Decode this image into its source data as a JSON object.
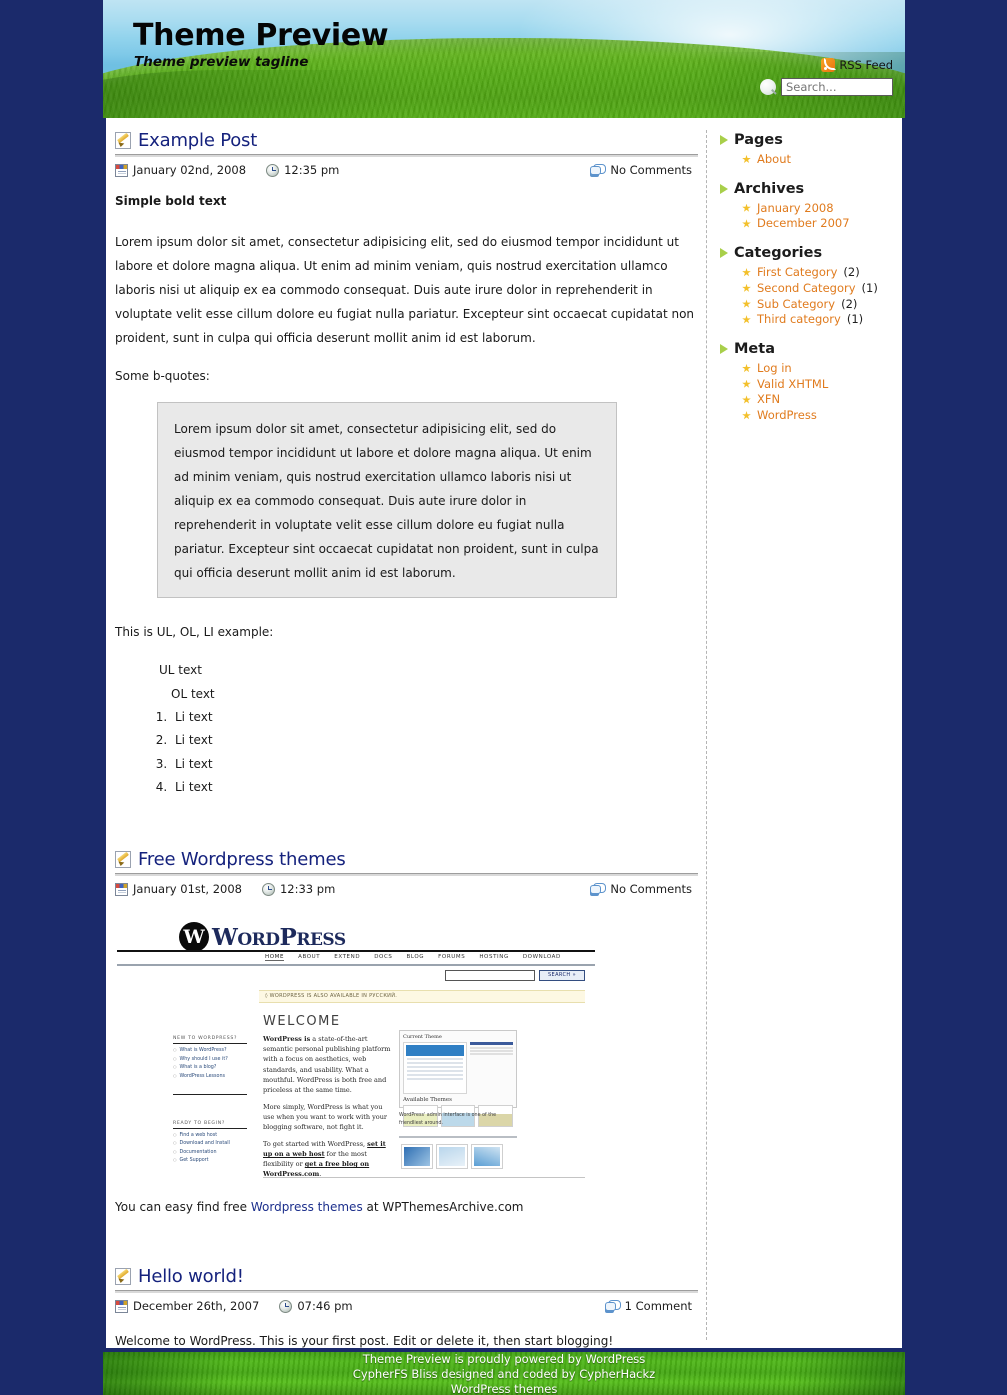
{
  "header": {
    "title": "Theme Preview",
    "tagline": "Theme preview tagline",
    "rss_label": "RSS Feed",
    "search_placeholder": "Search..."
  },
  "posts": [
    {
      "title": "Example Post",
      "date": "January 02nd, 2008",
      "time": "12:35 pm",
      "comments": "No Comments",
      "bold_lead": "Simple bold text",
      "paragraph": "Lorem ipsum dolor sit amet, consectetur adipisicing elit, sed do eiusmod tempor incididunt ut labore et dolore magna aliqua. Ut enim ad minim veniam, quis nostrud exercitation ullamco laboris nisi ut aliquip ex ea commodo consequat. Duis aute irure dolor in reprehenderit in voluptate velit esse cillum dolore eu fugiat nulla pariatur. Excepteur sint occaecat cupidatat non proident, sunt in culpa qui officia deserunt mollit anim id est laborum.",
      "bquote_intro": "Some b-quotes:",
      "blockquote": "Lorem ipsum dolor sit amet, consectetur adipisicing elit, sed do eiusmod tempor incididunt ut labore et dolore magna aliqua. Ut enim ad minim veniam, quis nostrud exercitation ullamco laboris nisi ut aliquip ex ea commodo consequat. Duis aute irure dolor in reprehenderit in voluptate velit esse cillum dolore eu fugiat nulla pariatur. Excepteur sint occaecat cupidatat non proident, sunt in culpa qui officia deserunt mollit anim id est laborum.",
      "list_intro": "This is UL, OL, LI example:",
      "ul_text": "UL text",
      "ol_text": "OL text",
      "li_items": [
        "Li text",
        "Li text",
        "Li text",
        "Li text"
      ]
    },
    {
      "title": "Free Wordpress themes",
      "date": "January 01st, 2008",
      "time": "12:33 pm",
      "comments": "No Comments",
      "closing_before": "You can easy find free ",
      "closing_link": "Wordpress themes",
      "closing_after": " at WPThemesArchive.com"
    },
    {
      "title": "Hello world!",
      "date": "December 26th, 2007",
      "time": "07:46 pm",
      "comments": "1 Comment",
      "body": "Welcome to WordPress. This is your first post. Edit or delete it, then start blogging!"
    }
  ],
  "embedded_screenshot": {
    "wordmark_word": "W",
    "wordmark_ord": "ORD",
    "wordmark_p": "P",
    "wordmark_ress": "RESS",
    "nav": [
      "HOME",
      "ABOUT",
      "EXTEND",
      "DOCS",
      "BLOG",
      "FORUMS",
      "HOSTING",
      "DOWNLOAD"
    ],
    "search_button": "SEARCH »",
    "notice": "◊ WORDPRESS IS ALSO AVAILABLE IN РУССКИЙ.",
    "welcome": "WELCOME",
    "new_header": "NEW TO WORDPRESS?",
    "new_links": [
      "What is WordPress?",
      "Why should I use it?",
      "What is a blog?",
      "WordPress Lessons"
    ],
    "ready_header": "READY TO BEGIN?",
    "ready_links": [
      "Find a web host",
      "Download and Install",
      "Documentation",
      "Get Support"
    ],
    "para1_bold": "WordPress is",
    "para1": " a state-of-the-art semantic personal publishing platform with a focus on aesthetics, web standards, and usability. What a mouthful. WordPress is both free and priceless at the same time.",
    "para2": "More simply, WordPress is what you use when you want to work with your blogging software, not fight it.",
    "para3_a": "To get started with WordPress, ",
    "para3_link1": "set it up on a web host",
    "para3_b": " for the most flexibility or ",
    "para3_link2": "get a free blog on WordPress.com",
    "para3_c": ".",
    "current_theme": "Current Theme",
    "available_themes": "Available Themes",
    "caption": "WordPress' admin interface is one of the friendliest around."
  },
  "sidebar": {
    "blocks": [
      {
        "heading": "Pages",
        "items": [
          {
            "label": "About",
            "count": ""
          }
        ]
      },
      {
        "heading": "Archives",
        "items": [
          {
            "label": "January 2008",
            "count": ""
          },
          {
            "label": "December 2007",
            "count": ""
          }
        ]
      },
      {
        "heading": "Categories",
        "items": [
          {
            "label": "First Category",
            "count": "(2)"
          },
          {
            "label": "Second Category",
            "count": "(1)"
          },
          {
            "label": "Sub Category",
            "count": "(2)"
          },
          {
            "label": "Third category",
            "count": "(1)"
          }
        ]
      },
      {
        "heading": "Meta",
        "items": [
          {
            "label": "Log in",
            "count": ""
          },
          {
            "label": "Valid XHTML",
            "count": "",
            "abbr": "XHTML",
            "prefix": "Valid "
          },
          {
            "label": "XFN",
            "count": "",
            "abbr": "XFN",
            "prefix": ""
          },
          {
            "label": "WordPress",
            "count": ""
          }
        ]
      }
    ]
  },
  "footer": {
    "line1_a": "Theme Preview is proudly powered by ",
    "line1_link": "WordPress",
    "line2_a": "CypherFS Bliss designed and coded by ",
    "line2_link": "CypherHackz",
    "line3": "WordPress themes"
  },
  "colors": {
    "page_background": "#1b2a6b",
    "link_blue": "#1c2f8c",
    "sidebar_link_orange": "#e07b1e",
    "star_gold": "#f3c02b",
    "arrow_green": "#a8cf4a",
    "blockquote_bg": "#e9e9e9"
  }
}
